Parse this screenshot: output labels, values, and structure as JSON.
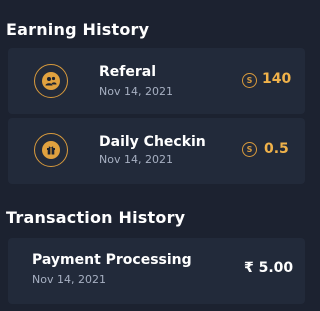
{
  "earning_history": {
    "title": "Earning History",
    "items": [
      {
        "title": "Referal",
        "date": "Nov 14, 2021",
        "coin_symbol": "S",
        "amount": "140",
        "icon": "referral-people-icon"
      },
      {
        "title": "Daily Checkin",
        "date": "Nov 14, 2021",
        "coin_symbol": "S",
        "amount": "0.5",
        "icon": "gift-icon"
      }
    ]
  },
  "transaction_history": {
    "title": "Transaction History",
    "items": [
      {
        "title": "Payment Processing",
        "date": "Nov 14, 2021",
        "amount": "₹ 5.00"
      }
    ]
  },
  "colors": {
    "background": "#1c2230",
    "card": "#222a3a",
    "accent": "#f0b24a",
    "muted_text": "#a7b0c2"
  }
}
